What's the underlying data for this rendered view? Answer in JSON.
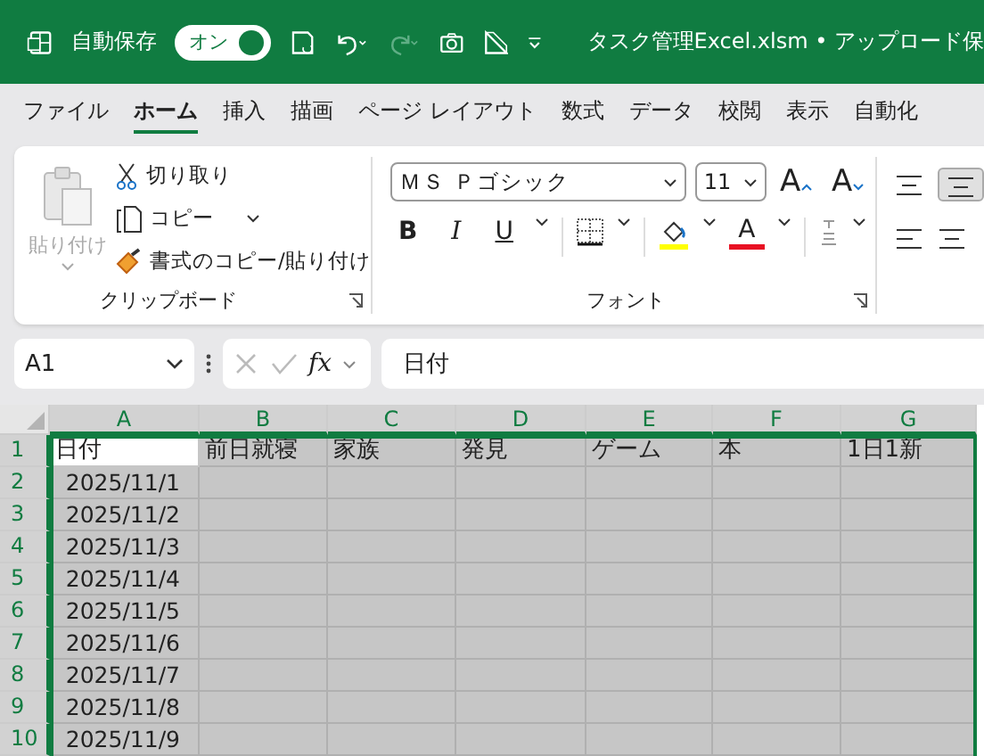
{
  "title_bar": {
    "autosave_label": "自動保存",
    "autosave_toggle": {
      "label": "オン",
      "on": true
    },
    "title": "タスク管理Excel.xlsm • アップロード保"
  },
  "tabs": [
    {
      "label": "ファイル",
      "selected": false
    },
    {
      "label": "ホーム",
      "selected": true
    },
    {
      "label": "挿入",
      "selected": false
    },
    {
      "label": "描画",
      "selected": false
    },
    {
      "label": "ページ レイアウト",
      "selected": false
    },
    {
      "label": "数式",
      "selected": false
    },
    {
      "label": "データ",
      "selected": false
    },
    {
      "label": "校閲",
      "selected": false
    },
    {
      "label": "表示",
      "selected": false
    },
    {
      "label": "自動化",
      "selected": false
    }
  ],
  "clipboard": {
    "paste": "貼り付け",
    "cut": "切り取り",
    "copy": "コピー",
    "format_painter": "書式のコピー/貼り付け",
    "group_label": "クリップボード"
  },
  "font": {
    "font_name": "ＭＳ Ｐゴシック",
    "font_size": "11",
    "bold": "B",
    "italic": "I",
    "underline": "U",
    "font_color": "A",
    "grow": "A",
    "shrink": "A",
    "group_label": "フォント"
  },
  "formula_bar": {
    "name_box": "A1",
    "fx": "fx",
    "value": "日付"
  },
  "grid": {
    "columns": [
      {
        "letter": "A",
        "selected": true
      },
      {
        "letter": "B",
        "selected": true
      },
      {
        "letter": "C",
        "selected": true
      },
      {
        "letter": "D",
        "selected": true
      },
      {
        "letter": "E",
        "selected": true
      },
      {
        "letter": "F",
        "selected": true
      },
      {
        "letter": "G",
        "selected": true
      }
    ],
    "rows": [
      {
        "number": "1",
        "selected": true,
        "active": true,
        "cells": [
          "日付",
          "前日就寝",
          "家族",
          "発見",
          "ゲーム",
          "本",
          "1日1新"
        ]
      },
      {
        "number": "2",
        "selected": true,
        "active": false,
        "cells": [
          "2025/11/1",
          "",
          "",
          "",
          "",
          "",
          ""
        ]
      },
      {
        "number": "3",
        "selected": true,
        "active": false,
        "cells": [
          "2025/11/2",
          "",
          "",
          "",
          "",
          "",
          ""
        ]
      },
      {
        "number": "4",
        "selected": true,
        "active": false,
        "cells": [
          "2025/11/3",
          "",
          "",
          "",
          "",
          "",
          ""
        ]
      },
      {
        "number": "5",
        "selected": true,
        "active": false,
        "cells": [
          "2025/11/4",
          "",
          "",
          "",
          "",
          "",
          ""
        ]
      },
      {
        "number": "6",
        "selected": true,
        "active": false,
        "cells": [
          "2025/11/5",
          "",
          "",
          "",
          "",
          "",
          ""
        ]
      },
      {
        "number": "7",
        "selected": true,
        "active": false,
        "cells": [
          "2025/11/6",
          "",
          "",
          "",
          "",
          "",
          ""
        ]
      },
      {
        "number": "8",
        "selected": true,
        "active": false,
        "cells": [
          "2025/11/7",
          "",
          "",
          "",
          "",
          "",
          ""
        ]
      },
      {
        "number": "9",
        "selected": true,
        "active": false,
        "cells": [
          "2025/11/8",
          "",
          "",
          "",
          "",
          "",
          ""
        ]
      },
      {
        "number": "10",
        "selected": true,
        "active": false,
        "cells": [
          "2025/11/9",
          "",
          "",
          "",
          "",
          "",
          ""
        ]
      }
    ]
  }
}
